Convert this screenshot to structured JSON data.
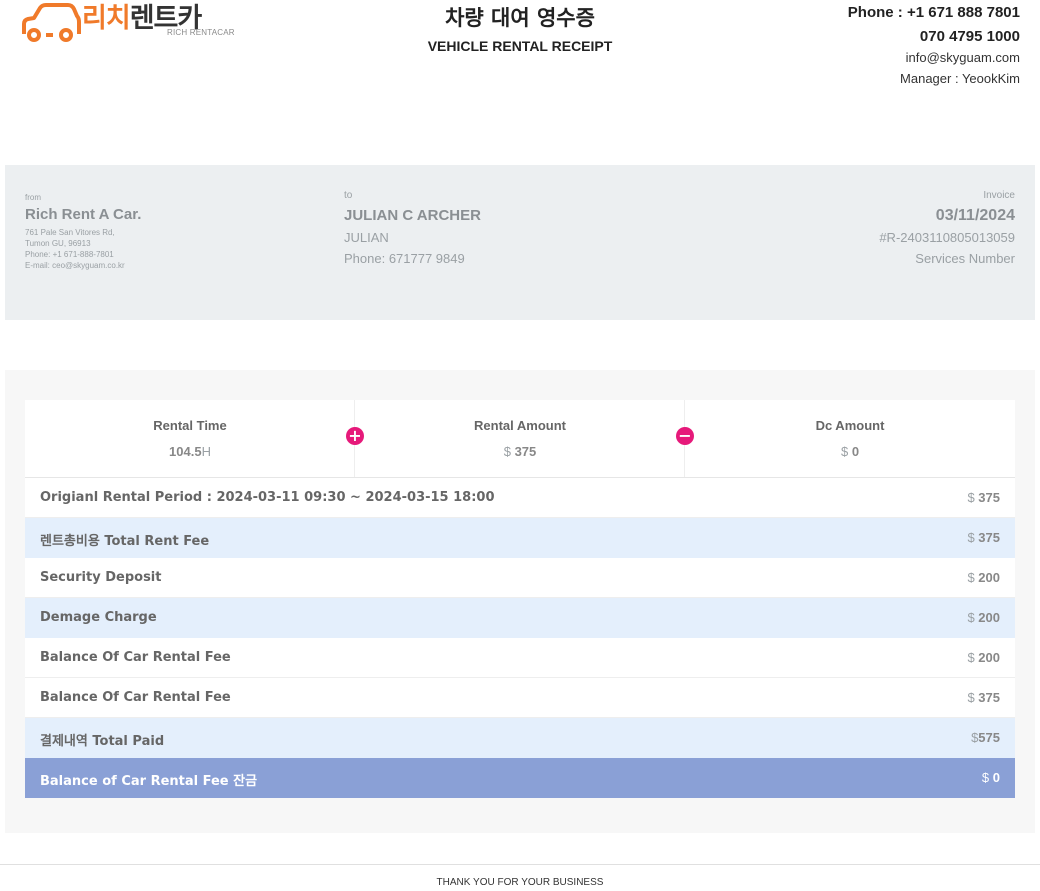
{
  "brand": {
    "name_kr_orange": "리치",
    "name_kr_black": "렌트카",
    "name_en": "RICH RENTACAR",
    "accent_color": "#f07a2a"
  },
  "title": {
    "korean": "차량 대여 영수증",
    "english": "VEHICLE RENTAL RECEIPT"
  },
  "contact": {
    "phone": "Phone : +1 671 888 7801",
    "phone2": "070 4795 1000",
    "email": "info@skyguam.com",
    "manager": "Manager : YeookKim"
  },
  "from": {
    "label": "from",
    "company": "Rich Rent A Car.",
    "address1": "761 Pale San Vitores Rd,",
    "address2": "Tumon GU, 96913",
    "phone": "Phone: +1 671-888-7801",
    "email": "E-mail: ceo@skyguam.co.kr"
  },
  "to": {
    "label": "to",
    "name": "JULIAN C ARCHER",
    "first_name": "JULIAN",
    "phone": "Phone: 671777 9849"
  },
  "invoice": {
    "label": "Invoice",
    "date": "03/11/2024",
    "number": "#R-2403110805013059",
    "services": "Services Number"
  },
  "summary": {
    "rental_time": {
      "label": "Rental Time",
      "value": "104.5",
      "unit": "H"
    },
    "rental_amount": {
      "label": "Rental Amount",
      "currency": "$",
      "value": "375"
    },
    "dc_amount": {
      "label": "Dc Amount",
      "currency": "$",
      "value": "0"
    },
    "plus_icon": "+",
    "minus_icon": "−",
    "icon_color": "#e6197a"
  },
  "rows": [
    {
      "label": "Origianl Rental Period : 2024-03-11 09:30 ~ 2024-03-15 18:00",
      "currency": "$",
      "amount": "375",
      "style": "plain"
    },
    {
      "label": "렌트총비용 Total Rent Fee",
      "currency": "$",
      "amount": "375",
      "style": "blue"
    },
    {
      "label": "Security Deposit",
      "currency": "$",
      "amount": "200",
      "style": "plain"
    },
    {
      "label": "Demage Charge",
      "currency": "$",
      "amount": "200",
      "style": "blue"
    },
    {
      "label": "Balance Of Car Rental Fee",
      "currency": "$",
      "amount": "200",
      "style": "plain"
    },
    {
      "label": "Balance Of Car Rental Fee",
      "currency": "$",
      "amount": "375",
      "style": "plain"
    },
    {
      "label": "결제내역 Total Paid",
      "currency": "$",
      "amount": "575",
      "style": "blue"
    },
    {
      "label": "Balance of Car Rental Fee 잔금",
      "currency": "$",
      "amount": "0",
      "style": "dark"
    }
  ],
  "footer": "THANK YOU FOR YOUR BUSINESS"
}
